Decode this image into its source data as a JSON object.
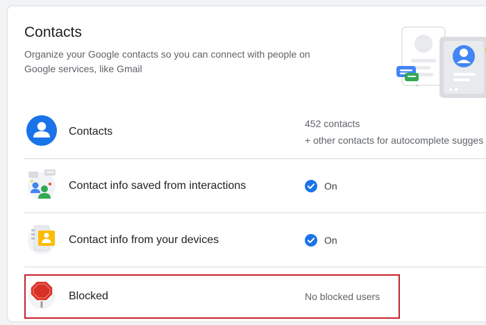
{
  "header": {
    "title": "Contacts",
    "description": "Organize your Google contacts so you can connect with people on Google services, like Gmail"
  },
  "rows": [
    {
      "label": "Contacts",
      "line1": "452 contacts",
      "line2": "+ other contacts for autocomplete sugges"
    },
    {
      "label": "Contact info saved from interactions",
      "status": "On"
    },
    {
      "label": "Contact info from your devices",
      "status": "On"
    },
    {
      "label": "Blocked",
      "value": "No blocked users"
    }
  ],
  "icons": {
    "contacts": "person-icon",
    "interactions": "chat-people-icon",
    "devices": "phone-contacts-icon",
    "blocked": "stop-sign-icon",
    "status_on": "check-circle-icon"
  },
  "colors": {
    "accent_blue": "#1a73e8",
    "highlight_red": "#c5232b",
    "stop_red": "#d93025"
  }
}
